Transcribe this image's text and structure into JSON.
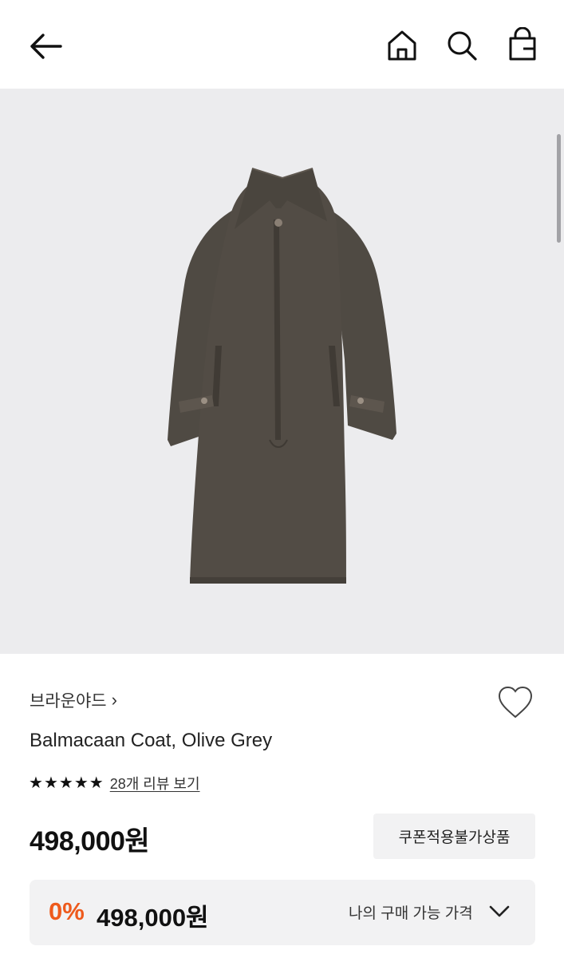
{
  "header": {
    "back_icon": "arrow-left-icon",
    "home_icon": "home-icon",
    "search_icon": "search-icon",
    "bag_icon": "shopping-bag-icon"
  },
  "gallery": {
    "background": "#ececee",
    "coat_color": "#4f4a43"
  },
  "product": {
    "brand": "브라운야드",
    "brand_chevron": "›",
    "title": "Balmacaan Coat, Olive Grey",
    "rating_stars": 5,
    "review_link": "28개 리뷰 보기",
    "price": "498,000원",
    "coupon_badge": "쿠폰적용불가상품",
    "wishlist_icon": "heart-outline-icon"
  },
  "my_price": {
    "discount": "0%",
    "price": "498,000원",
    "label": "나의 구매 가능 가격",
    "accent": "#ee5a1c"
  }
}
